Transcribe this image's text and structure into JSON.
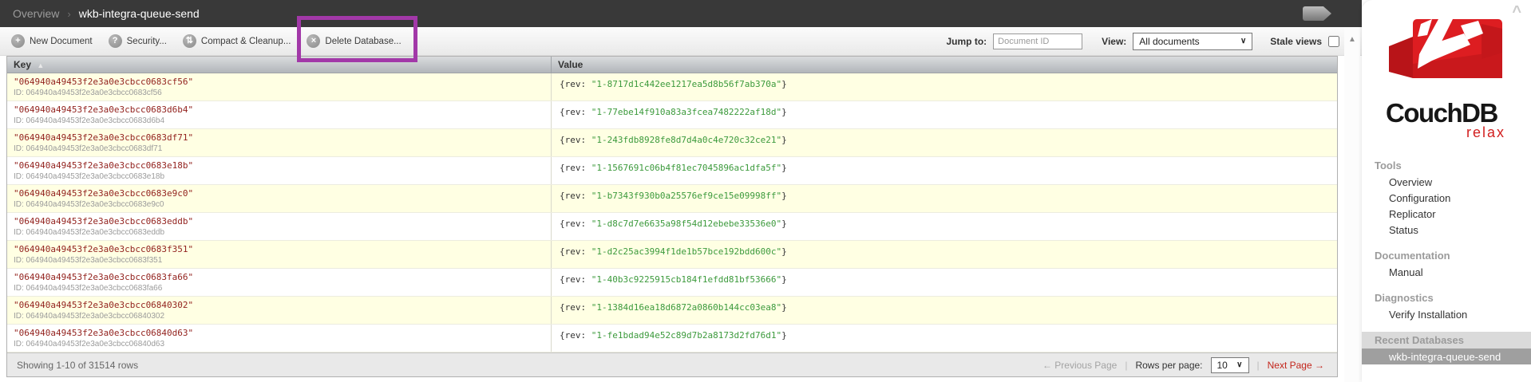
{
  "header": {
    "breadcrumb": {
      "root": "Overview",
      "separator": "›",
      "current": "wkb-integra-queue-send"
    }
  },
  "toolbar": {
    "buttons": [
      {
        "label": "New Document",
        "glyph": "+"
      },
      {
        "label": "Security...",
        "glyph": "?"
      },
      {
        "label": "Compact & Cleanup...",
        "glyph": "⇅"
      },
      {
        "label": "Delete Database...",
        "glyph": "×"
      }
    ],
    "jump": {
      "label": "Jump to:",
      "placeholder": "Document ID",
      "value": ""
    },
    "view": {
      "label": "View:",
      "selected": "All documents",
      "chevron": "∨"
    },
    "stale": {
      "label": "Stale views",
      "checked": false
    }
  },
  "table": {
    "columns": {
      "key": "Key",
      "value": "Value"
    },
    "sort_icon": "▲",
    "value_open": "{rev: ",
    "value_close": "}",
    "rows": [
      {
        "key": "\"064940a49453f2e3a0e3cbcc0683cf56\"",
        "id": "ID: 064940a49453f2e3a0e3cbcc0683cf56",
        "rev": "\"1-8717d1c442ee1217ea5d8b56f7ab370a\""
      },
      {
        "key": "\"064940a49453f2e3a0e3cbcc0683d6b4\"",
        "id": "ID: 064940a49453f2e3a0e3cbcc0683d6b4",
        "rev": "\"1-77ebe14f910a83a3fcea7482222af18d\""
      },
      {
        "key": "\"064940a49453f2e3a0e3cbcc0683df71\"",
        "id": "ID: 064940a49453f2e3a0e3cbcc0683df71",
        "rev": "\"1-243fdb8928fe8d7d4a0c4e720c32ce21\""
      },
      {
        "key": "\"064940a49453f2e3a0e3cbcc0683e18b\"",
        "id": "ID: 064940a49453f2e3a0e3cbcc0683e18b",
        "rev": "\"1-1567691c06b4f81ec7045896ac1dfa5f\""
      },
      {
        "key": "\"064940a49453f2e3a0e3cbcc0683e9c0\"",
        "id": "ID: 064940a49453f2e3a0e3cbcc0683e9c0",
        "rev": "\"1-b7343f930b0a25576ef9ce15e09998ff\""
      },
      {
        "key": "\"064940a49453f2e3a0e3cbcc0683eddb\"",
        "id": "ID: 064940a49453f2e3a0e3cbcc0683eddb",
        "rev": "\"1-d8c7d7e6635a98f54d12ebebe33536e0\""
      },
      {
        "key": "\"064940a49453f2e3a0e3cbcc0683f351\"",
        "id": "ID: 064940a49453f2e3a0e3cbcc0683f351",
        "rev": "\"1-d2c25ac3994f1de1b57bce192bdd600c\""
      },
      {
        "key": "\"064940a49453f2e3a0e3cbcc0683fa66\"",
        "id": "ID: 064940a49453f2e3a0e3cbcc0683fa66",
        "rev": "\"1-40b3c9225915cb184f1efdd81bf53666\""
      },
      {
        "key": "\"064940a49453f2e3a0e3cbcc06840302\"",
        "id": "ID: 064940a49453f2e3a0e3cbcc06840302",
        "rev": "\"1-1384d16ea18d6872a0860b144cc03ea8\""
      },
      {
        "key": "\"064940a49453f2e3a0e3cbcc06840d63\"",
        "id": "ID: 064940a49453f2e3a0e3cbcc06840d63",
        "rev": "\"1-fe1bdad94e52c89d7b2a8173d2fd76d1\""
      }
    ]
  },
  "footer": {
    "status": "Showing 1-10 of 31514 rows",
    "prev": "← Previous Page",
    "separator": "|",
    "rows_per_page_label": "Rows per page:",
    "rows_per_page_value": "10",
    "chevron": "∨",
    "next": "Next Page →"
  },
  "scrollbar": {
    "up_glyph": "▲"
  },
  "sidebar": {
    "collapse_glyph": "^",
    "logo": {
      "title": "CouchDB",
      "tagline": "relax"
    },
    "sections": [
      {
        "heading": "Tools",
        "items": [
          "Overview",
          "Configuration",
          "Replicator",
          "Status"
        ]
      },
      {
        "heading": "Documentation",
        "items": [
          "Manual"
        ]
      },
      {
        "heading": "Diagnostics",
        "items": [
          "Verify Installation"
        ]
      },
      {
        "heading": "Recent Databases",
        "items": [
          "wkb-integra-queue-send"
        ]
      }
    ],
    "selected_database": "wkb-integra-queue-send"
  },
  "annotation": {
    "highlight_color": "#a238a8",
    "highlighted_button": "Delete Database..."
  }
}
